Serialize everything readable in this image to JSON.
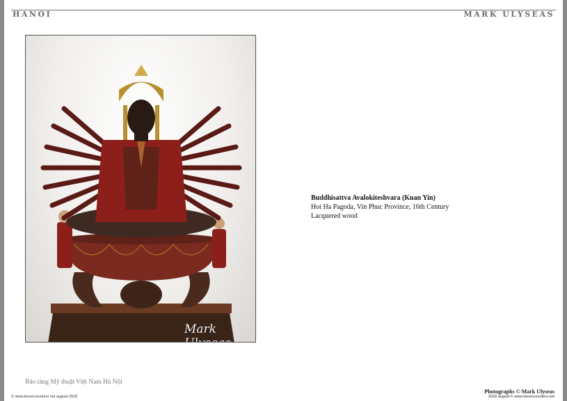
{
  "header": {
    "left_title": "HANOI",
    "right_title": "MARK ULYSEAS"
  },
  "photo": {
    "subject": "carved-statue-image",
    "watermark": "Mark Ulyseas"
  },
  "caption": {
    "title": "Buddhisattva  Avalokiteshvara  (Kuan Yin)",
    "line2": "Hoi Ha Pagoda, Vin Phuc Province, 16th Century",
    "line3": "Lacquered wood"
  },
  "footer": {
    "museum": "Bảo tàng Mỹ thuật Việt Nam Hà Nội",
    "copyright_left": "© www.liveencounters.net  august 2018",
    "credit_line1": "Photographs © Mark Ulyseas",
    "credit_line2": "2018 august © www.liveencounters.net"
  },
  "colors": {
    "lacquer_red": "#8c1f1a",
    "gold": "#b8902f",
    "dark_wood": "#3a2418",
    "header_gray": "#6a6a6a"
  }
}
